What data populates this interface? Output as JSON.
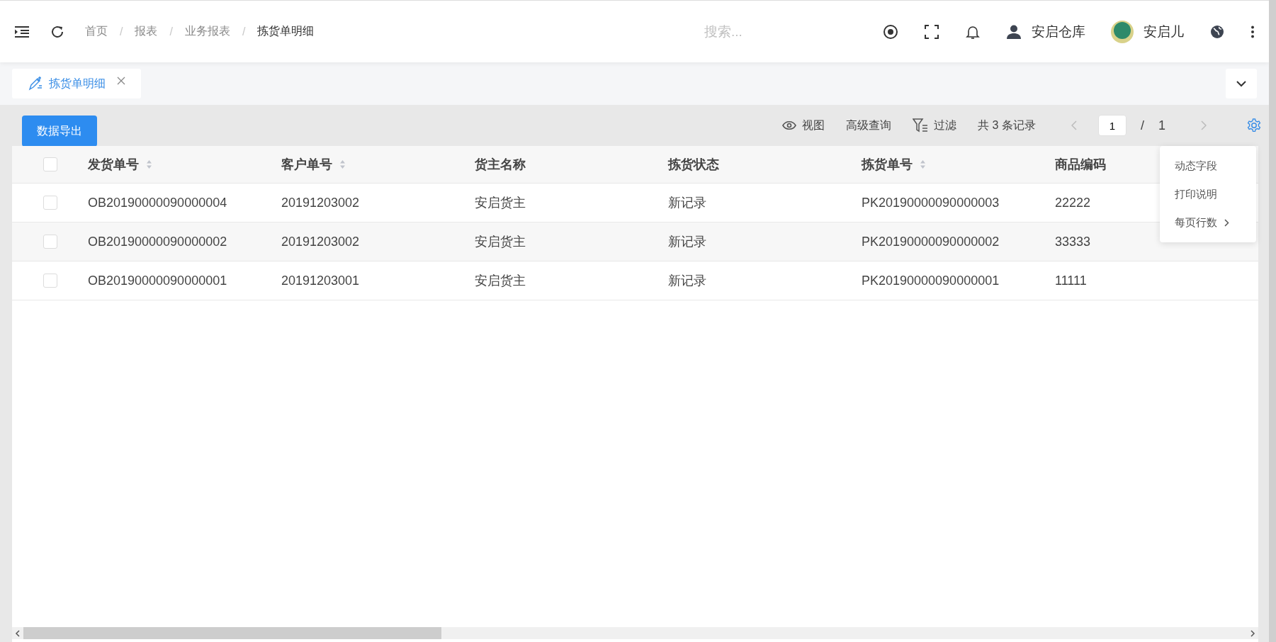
{
  "header": {
    "breadcrumbs": [
      {
        "label": "首页",
        "current": false,
        "separator": "/"
      },
      {
        "label": "报表",
        "current": false,
        "separator": "/"
      },
      {
        "label": "业务报表",
        "current": false,
        "separator": "/"
      },
      {
        "label": "拣货单明细",
        "current": true
      }
    ],
    "search": {
      "placeholder": "搜索..."
    },
    "warehouse": "安启仓库",
    "user": "安启儿"
  },
  "tabs": [
    {
      "label": "拣货单明细",
      "selected": true
    }
  ],
  "toolbar": {
    "export_button": "数据导出",
    "view": "视图",
    "advanced_query": "高级查询",
    "filter": "过滤",
    "record_count": "共 3 条记录",
    "page": "1",
    "page_separator": "/",
    "page_total": "1"
  },
  "table": {
    "header_checked": false,
    "columns": [
      {
        "label": "发货单号",
        "sortable": true
      },
      {
        "label": "客户单号",
        "sortable": true
      },
      {
        "label": "货主名称",
        "sortable": false
      },
      {
        "label": "拣货状态",
        "sortable": false
      },
      {
        "label": "拣货单号",
        "sortable": true
      },
      {
        "label": "商品编码",
        "sortable": false
      }
    ],
    "rows": [
      {
        "checked": false,
        "cells": [
          "OB20190000090000004",
          "20191203002",
          "安启货主",
          "新记录",
          "PK20190000090000003",
          "22222"
        ]
      },
      {
        "checked": false,
        "cells": [
          "OB20190000090000002",
          "20191203002",
          "安启货主",
          "新记录",
          "PK20190000090000002",
          "33333"
        ]
      },
      {
        "checked": false,
        "cells": [
          "OB20190000090000001",
          "20191203001",
          "安启货主",
          "新记录",
          "PK20190000090000001",
          "11111"
        ]
      }
    ]
  },
  "settings_menu": {
    "items": [
      {
        "label": "动态字段",
        "submenu": false
      },
      {
        "label": "打印说明",
        "submenu": false
      },
      {
        "label": "每页行数",
        "submenu": true
      }
    ]
  }
}
